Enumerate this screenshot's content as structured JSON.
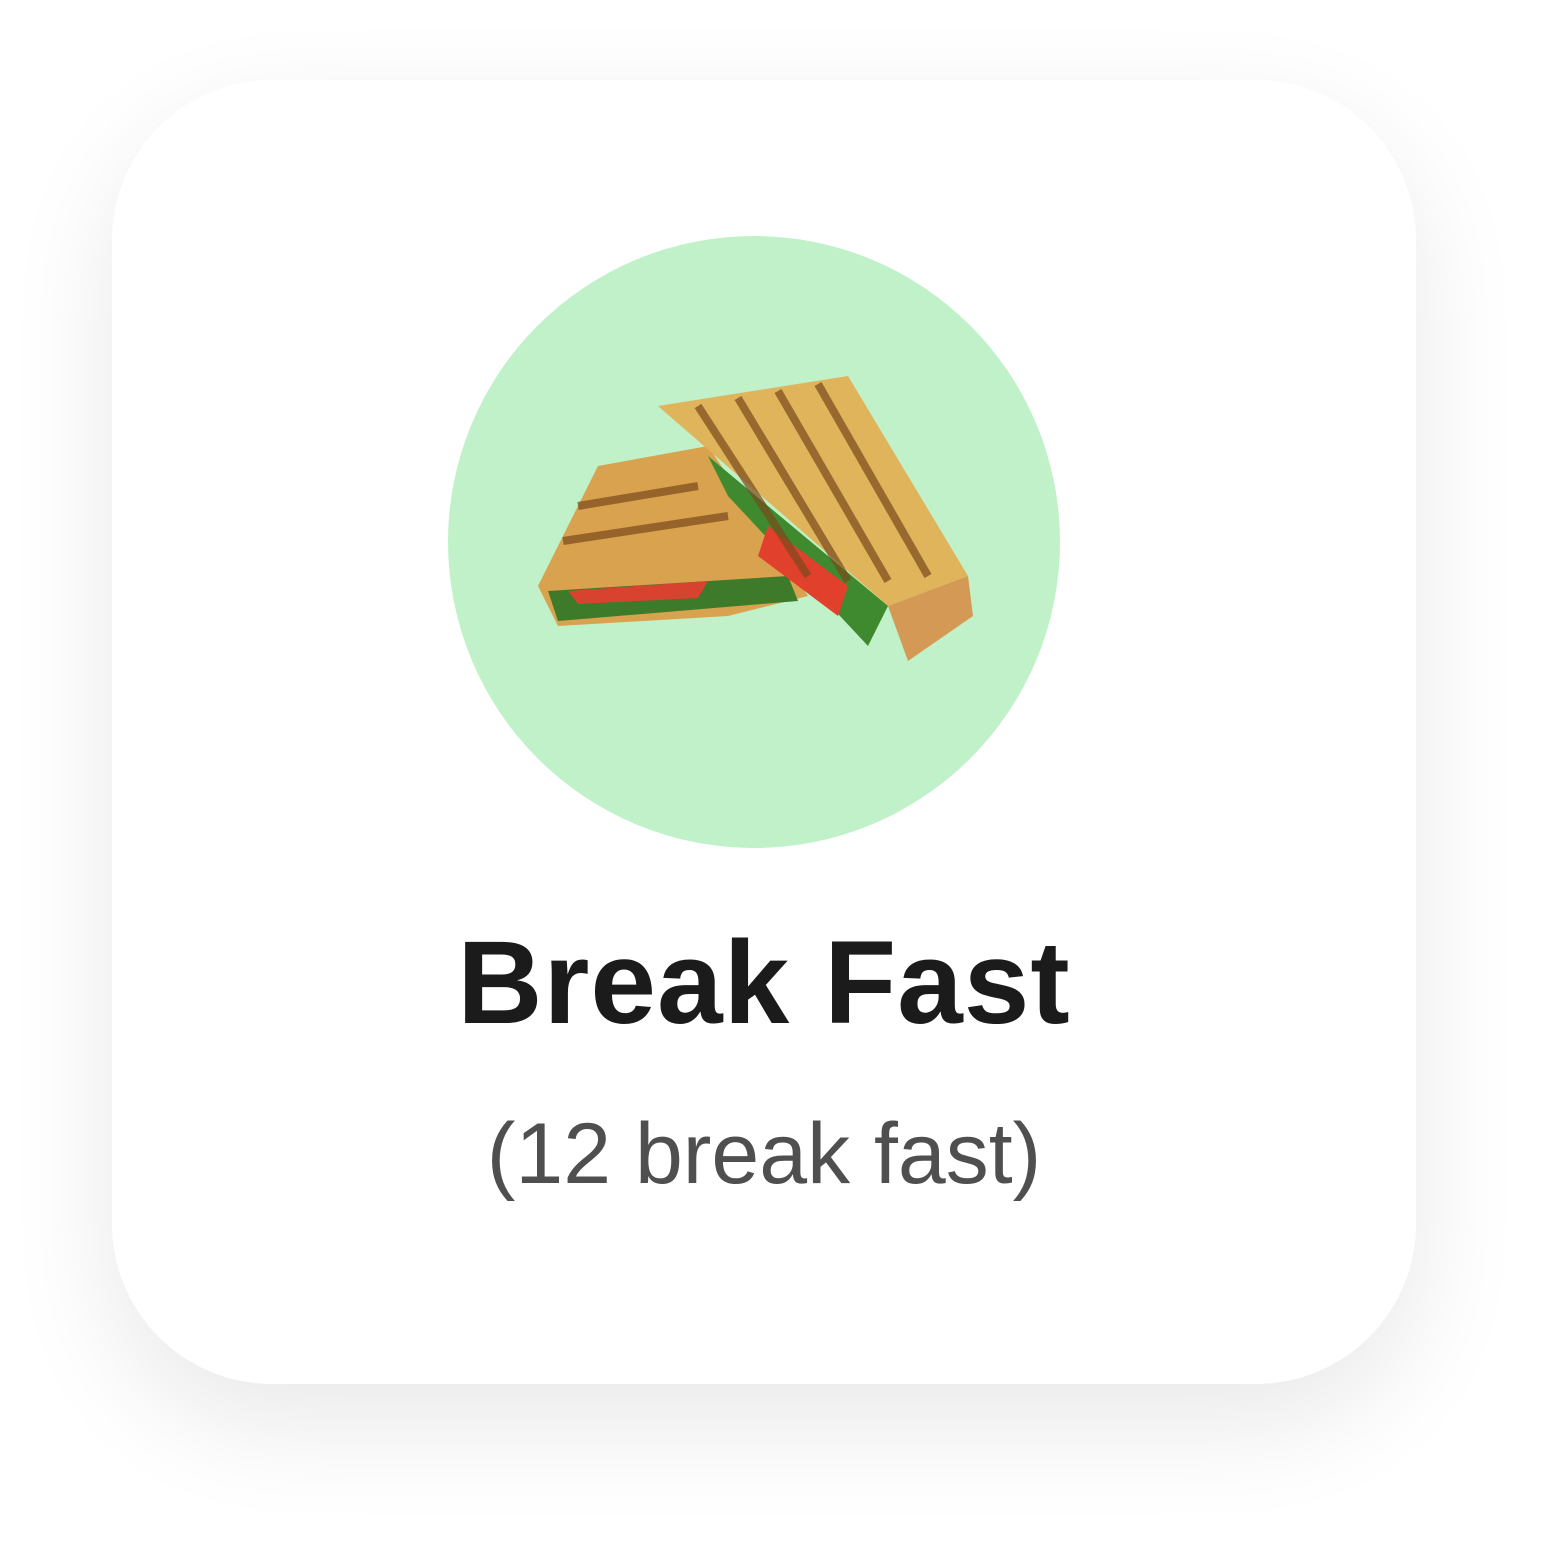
{
  "category": {
    "title": "Break Fast",
    "subtitle": "(12 break fast)",
    "icon": "sandwich-image",
    "circle_color": "#c0f1c9"
  }
}
